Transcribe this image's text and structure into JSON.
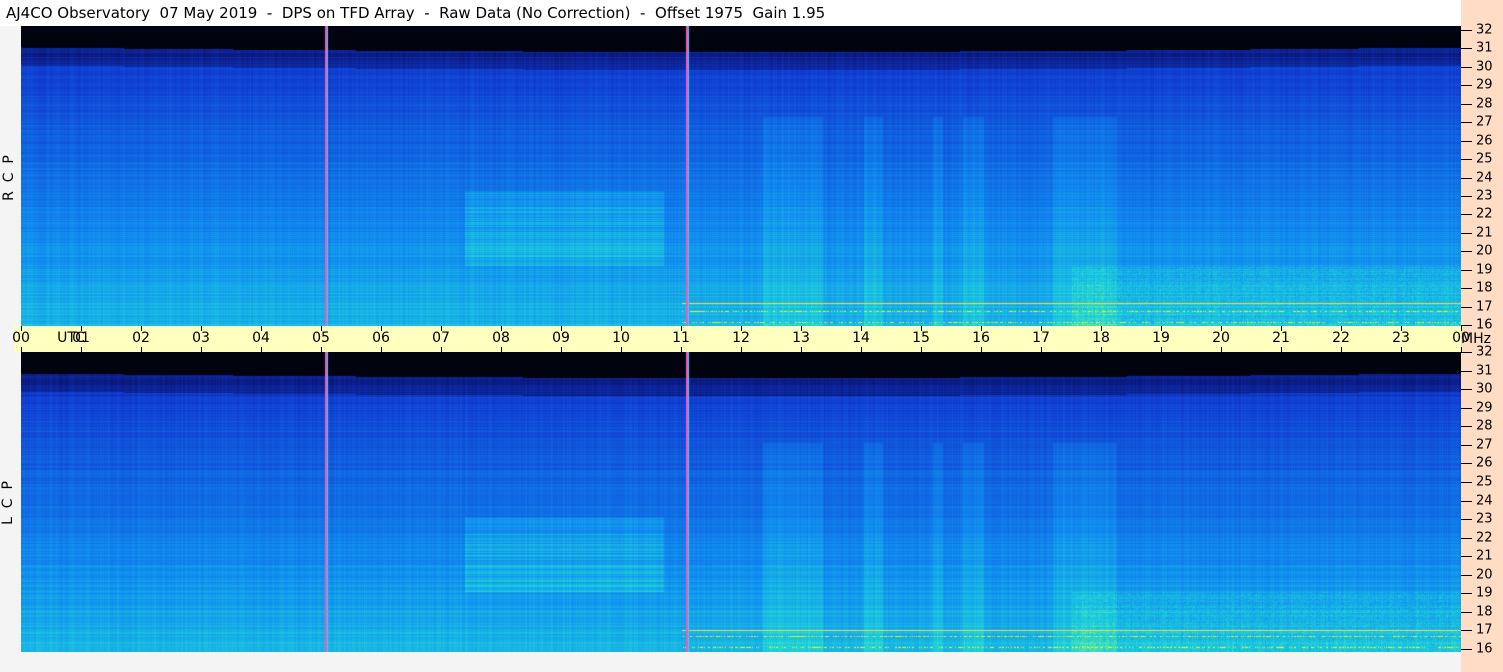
{
  "title": "AJ4CO Observatory  07 May 2019  -  DPS on TFD Array  -  Raw Data (No Correction)  -  Offset 1975  Gain 1.95",
  "chart_data": {
    "type": "heatmap",
    "title": "AJ4CO Observatory  07 May 2019  -  DPS on TFD Array  -  Raw Data (No Correction)  -  Offset 1975  Gain 1.95",
    "xlabel": "UTC",
    "ylabel": "MHz",
    "xlim": [
      0,
      24
    ],
    "ylim": [
      16,
      32
    ],
    "x_ticks": [
      "00",
      "01",
      "02",
      "03",
      "04",
      "05",
      "06",
      "07",
      "08",
      "09",
      "10",
      "11",
      "12",
      "13",
      "14",
      "15",
      "16",
      "17",
      "18",
      "19",
      "20",
      "21",
      "22",
      "23",
      "00"
    ],
    "y_ticks": [
      "32",
      "31",
      "30",
      "29",
      "28",
      "27",
      "26",
      "25",
      "24",
      "23",
      "22",
      "21",
      "20",
      "19",
      "18",
      "17",
      "16"
    ],
    "panels": [
      {
        "label": "R  C  P"
      },
      {
        "label": "L  C  P"
      }
    ],
    "markers_utc": [
      5.07,
      11.08
    ],
    "bright_band_utc": [
      7.4,
      10.7
    ],
    "colormap": [
      "#000000",
      "#0a1a80",
      "#1040d0",
      "#1090f0",
      "#20d0e0",
      "#80f080",
      "#ffff00",
      "#ff40ff"
    ]
  },
  "axis": {
    "utc_label": "UTC",
    "mhz_label": "MHz"
  }
}
